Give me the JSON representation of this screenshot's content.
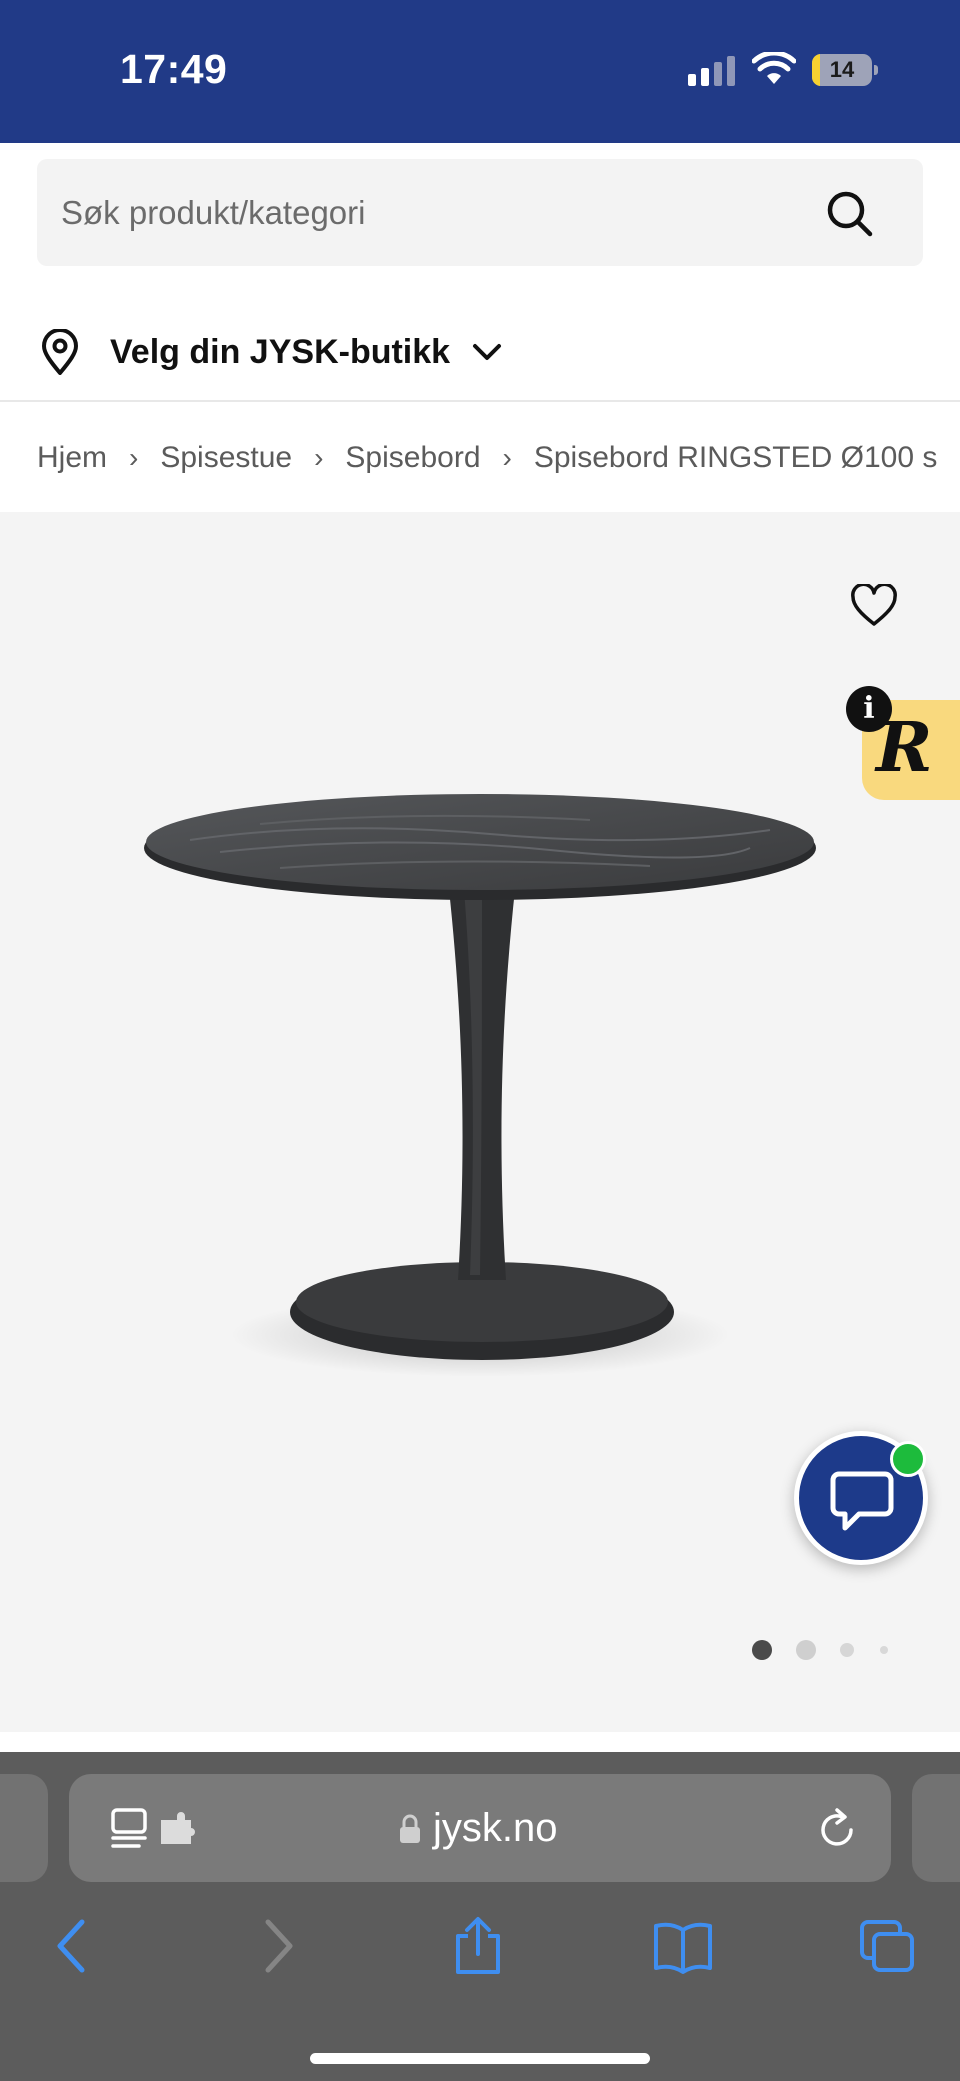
{
  "status_bar": {
    "time": "17:49",
    "battery_level": "14",
    "battery_fraction": 0.14
  },
  "search": {
    "placeholder": "Søk produkt/kategori"
  },
  "store": {
    "label": "Velg din JYSK-butikk"
  },
  "breadcrumb": {
    "items": [
      "Hjem",
      "Spisestue",
      "Spisebord",
      "Spisebord RINGSTED Ø100 s"
    ],
    "separator": "›"
  },
  "product": {
    "favorite_icon": "heart-icon",
    "badge_letter": "R",
    "info_letter": "i",
    "gallery_count": 4,
    "gallery_active": 0
  },
  "chat": {
    "icon": "chat-bubble-icon",
    "status": "online"
  },
  "browser": {
    "url": "jysk.no"
  },
  "colors": {
    "brand_blue": "#213a87",
    "badge_yellow": "#f9d97e",
    "online_green": "#1dbb3c",
    "safari_blue": "#3f8ef0"
  }
}
